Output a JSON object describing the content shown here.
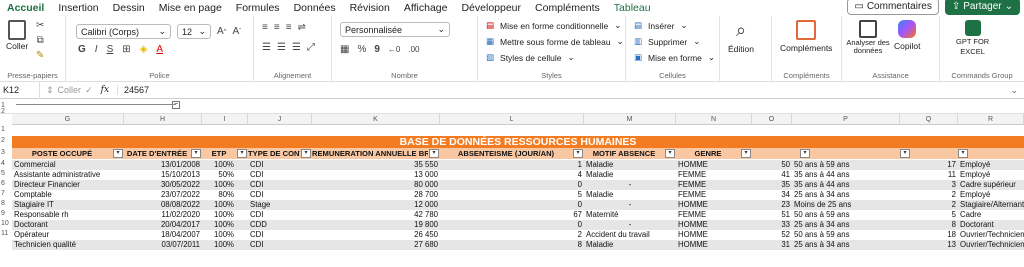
{
  "tabs": [
    "Accueil",
    "Insertion",
    "Dessin",
    "Mise en page",
    "Formules",
    "Données",
    "Révision",
    "Affichage",
    "Développeur",
    "Compléments",
    "Tableau"
  ],
  "top_buttons": {
    "comments": "Commentaires",
    "share": "Partager"
  },
  "ribbon": {
    "clipboard": {
      "paste": "Coller",
      "label": "Presse-papiers"
    },
    "font": {
      "family": "Calibri (Corps)",
      "size": "12",
      "label": "Police",
      "bold": "G",
      "italic": "I",
      "underline": "S"
    },
    "alignment": {
      "label": "Alignement"
    },
    "number": {
      "format": "Personnalisée",
      "percent": "%",
      "thousands": "9",
      "label": "Nombre"
    },
    "styles": {
      "conditional": "Mise en forme conditionnelle",
      "as_table": "Mettre sous forme de tableau",
      "cell_styles": "Styles de cellule",
      "label": "Styles"
    },
    "cells": {
      "insert": "Insérer",
      "delete": "Supprimer",
      "format": "Mise en forme",
      "label": "Cellules"
    },
    "edit": {
      "label": "Édition"
    },
    "addins": {
      "button": "Compléments",
      "label": "Compléments"
    },
    "assistance": {
      "analyze": "Analyser des données",
      "copilot": "Copilot",
      "label": "Assistance"
    },
    "commands": {
      "gpt1": "GPT FOR",
      "gpt2": "EXCEL",
      "label": "Commands Group"
    }
  },
  "formula_bar": {
    "cell_ref": "K12",
    "paste_hint": "Coller",
    "fx": "fx",
    "value": "24567"
  },
  "columns": [
    "G",
    "H",
    "I",
    "J",
    "K",
    "L",
    "M",
    "N",
    "O",
    "P",
    "Q",
    "R"
  ],
  "row_numbers": [
    "1",
    "2",
    "1",
    "2",
    "3",
    "4",
    "5",
    "6",
    "7",
    "8",
    "9",
    "10",
    "11"
  ],
  "sheet": {
    "title": "BASE DE DONNÉES RESSOURCES HUMAINES",
    "headers": [
      "POSTE OCCUPÉ",
      "DATE D'ENTRÉE",
      "ETP",
      "TYPE DE CONTRAT",
      "REMUNERATION ANNUELLE BRUTE",
      "ABSENTEISME (JOUR/AN)",
      "MOTIF ABSENCE",
      "GENRE"
    ],
    "rows": [
      [
        "Commercial",
        "13/01/2008",
        "100%",
        "CDI",
        "35 550",
        "1",
        "Maladie",
        "HOMME",
        "50",
        "50 ans à 59 ans",
        "17",
        "Employé"
      ],
      [
        "Assistante administrative",
        "15/10/2013",
        "50%",
        "CDI",
        "13 000",
        "4",
        "Maladie",
        "FEMME",
        "41",
        "35 ans à 44 ans",
        "11",
        "Employé"
      ],
      [
        "Directeur Financier",
        "30/05/2022",
        "100%",
        "CDI",
        "80 000",
        "0",
        "-",
        "FEMME",
        "35",
        "35 ans à 44 ans",
        "3",
        "Cadre supérieur"
      ],
      [
        "Comptable",
        "23/07/2022",
        "80%",
        "CDI",
        "28 700",
        "5",
        "Maladie",
        "FEMME",
        "34",
        "25 ans à 34 ans",
        "2",
        "Employé"
      ],
      [
        "Stagiaire IT",
        "08/08/2022",
        "100%",
        "Stage",
        "12 000",
        "0",
        "-",
        "HOMME",
        "23",
        "Moins de 25 ans",
        "2",
        "Stagiaire/Alternant"
      ],
      [
        "Responsable rh",
        "11/02/2020",
        "100%",
        "CDI",
        "42 780",
        "67",
        "Maternité",
        "FEMME",
        "51",
        "50 ans à 59 ans",
        "5",
        "Cadre"
      ],
      [
        "Doctorant",
        "20/04/2017",
        "100%",
        "CDD",
        "19 800",
        "0",
        "-",
        "HOMME",
        "33",
        "25 ans à 34 ans",
        "8",
        "Doctorant"
      ],
      [
        "Opérateur",
        "18/04/2007",
        "100%",
        "CDI",
        "26 450",
        "2",
        "Accident du travail",
        "HOMME",
        "52",
        "50 ans à 59 ans",
        "18",
        "Ouvrier/Technicien"
      ],
      [
        "Technicien qualité",
        "03/07/2011",
        "100%",
        "CDI",
        "27 680",
        "8",
        "Maladie",
        "HOMME",
        "31",
        "25 ans à 34 ans",
        "13",
        "Ouvrier/Technicien"
      ]
    ]
  },
  "colors": {
    "accent": "#1e7145",
    "title_bg": "#f37b21",
    "header_bg": "#f9c8a3",
    "band": "#e6e6e6"
  }
}
